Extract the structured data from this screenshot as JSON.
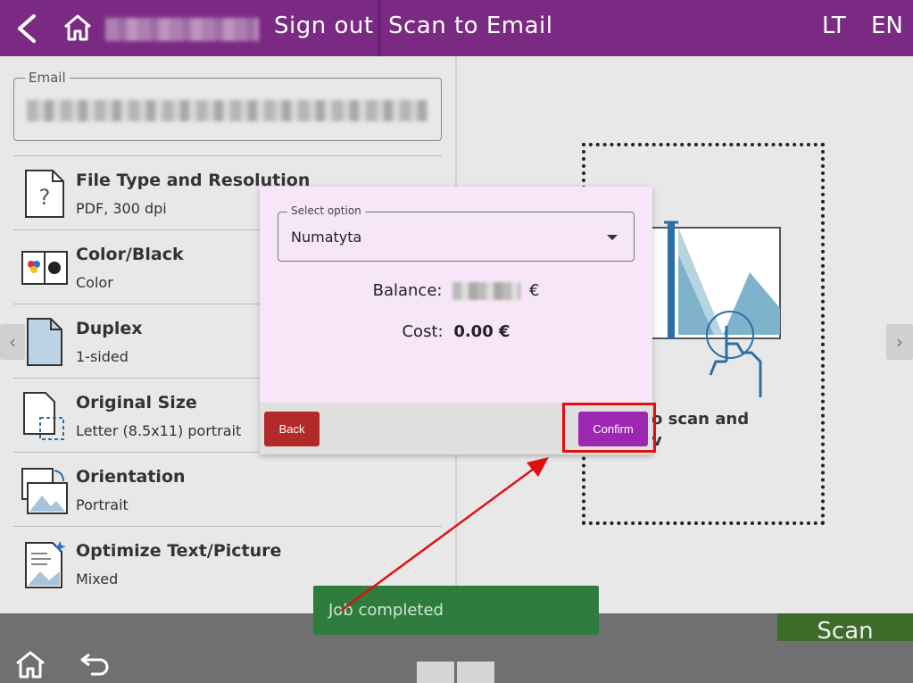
{
  "header": {
    "sign_out": "Sign out",
    "title": "Scan to Email",
    "lang_lt": "LT",
    "lang_en": "EN"
  },
  "email": {
    "label": "Email"
  },
  "settings": [
    {
      "title": "File Type and Resolution",
      "value": "PDF, 300 dpi",
      "icon": "file-type-icon"
    },
    {
      "title": "Color/Black",
      "value": "Color",
      "icon": "color-black-icon"
    },
    {
      "title": "Duplex",
      "value": "1-sided",
      "icon": "duplex-icon"
    },
    {
      "title": "Original Size",
      "value": "Letter (8.5x11) portrait",
      "icon": "original-size-icon"
    },
    {
      "title": "Orientation",
      "value": "Portrait",
      "icon": "orientation-icon"
    },
    {
      "title": "Optimize Text/Picture",
      "value": "Mixed",
      "icon": "optimize-icon"
    }
  ],
  "preview": {
    "text": "o scan and\nv"
  },
  "dialog": {
    "select_label": "Select option",
    "select_value": "Numatyta",
    "balance_label": "Balance:",
    "balance_currency": "€",
    "cost_label": "Cost:",
    "cost_value": "0.00 €",
    "back_label": "Back",
    "confirm_label": "Confirm"
  },
  "toast": {
    "text": "Job completed"
  },
  "bottom": {
    "scan_label": "Scan"
  },
  "colors": {
    "header": "#7b2a83",
    "confirm": "#9c27b0",
    "back": "#b22a2a",
    "toast": "#2e7d3e",
    "scan": "#3d6b2a",
    "annotation": "#e01010"
  }
}
